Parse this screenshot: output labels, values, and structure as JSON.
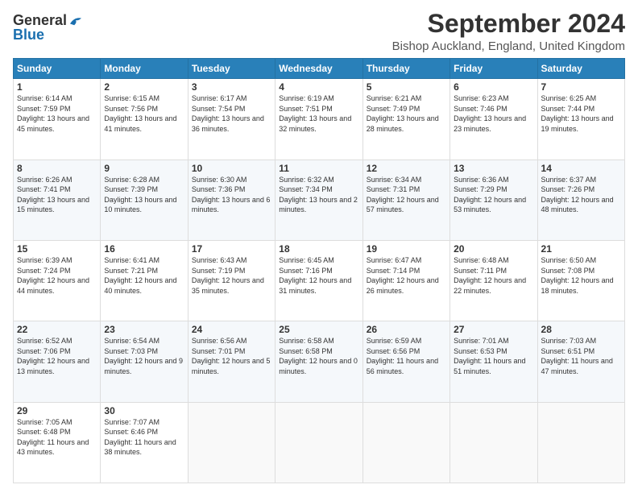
{
  "header": {
    "logo_general": "General",
    "logo_blue": "Blue",
    "month_title": "September 2024",
    "location": "Bishop Auckland, England, United Kingdom"
  },
  "days_of_week": [
    "Sunday",
    "Monday",
    "Tuesday",
    "Wednesday",
    "Thursday",
    "Friday",
    "Saturday"
  ],
  "weeks": [
    [
      {
        "day": "1",
        "sunrise": "6:14 AM",
        "sunset": "7:59 PM",
        "daylight": "13 hours and 45 minutes."
      },
      {
        "day": "2",
        "sunrise": "6:15 AM",
        "sunset": "7:56 PM",
        "daylight": "13 hours and 41 minutes."
      },
      {
        "day": "3",
        "sunrise": "6:17 AM",
        "sunset": "7:54 PM",
        "daylight": "13 hours and 36 minutes."
      },
      {
        "day": "4",
        "sunrise": "6:19 AM",
        "sunset": "7:51 PM",
        "daylight": "13 hours and 32 minutes."
      },
      {
        "day": "5",
        "sunrise": "6:21 AM",
        "sunset": "7:49 PM",
        "daylight": "13 hours and 28 minutes."
      },
      {
        "day": "6",
        "sunrise": "6:23 AM",
        "sunset": "7:46 PM",
        "daylight": "13 hours and 23 minutes."
      },
      {
        "day": "7",
        "sunrise": "6:25 AM",
        "sunset": "7:44 PM",
        "daylight": "13 hours and 19 minutes."
      }
    ],
    [
      {
        "day": "8",
        "sunrise": "6:26 AM",
        "sunset": "7:41 PM",
        "daylight": "13 hours and 15 minutes."
      },
      {
        "day": "9",
        "sunrise": "6:28 AM",
        "sunset": "7:39 PM",
        "daylight": "13 hours and 10 minutes."
      },
      {
        "day": "10",
        "sunrise": "6:30 AM",
        "sunset": "7:36 PM",
        "daylight": "13 hours and 6 minutes."
      },
      {
        "day": "11",
        "sunrise": "6:32 AM",
        "sunset": "7:34 PM",
        "daylight": "13 hours and 2 minutes."
      },
      {
        "day": "12",
        "sunrise": "6:34 AM",
        "sunset": "7:31 PM",
        "daylight": "12 hours and 57 minutes."
      },
      {
        "day": "13",
        "sunrise": "6:36 AM",
        "sunset": "7:29 PM",
        "daylight": "12 hours and 53 minutes."
      },
      {
        "day": "14",
        "sunrise": "6:37 AM",
        "sunset": "7:26 PM",
        "daylight": "12 hours and 48 minutes."
      }
    ],
    [
      {
        "day": "15",
        "sunrise": "6:39 AM",
        "sunset": "7:24 PM",
        "daylight": "12 hours and 44 minutes."
      },
      {
        "day": "16",
        "sunrise": "6:41 AM",
        "sunset": "7:21 PM",
        "daylight": "12 hours and 40 minutes."
      },
      {
        "day": "17",
        "sunrise": "6:43 AM",
        "sunset": "7:19 PM",
        "daylight": "12 hours and 35 minutes."
      },
      {
        "day": "18",
        "sunrise": "6:45 AM",
        "sunset": "7:16 PM",
        "daylight": "12 hours and 31 minutes."
      },
      {
        "day": "19",
        "sunrise": "6:47 AM",
        "sunset": "7:14 PM",
        "daylight": "12 hours and 26 minutes."
      },
      {
        "day": "20",
        "sunrise": "6:48 AM",
        "sunset": "7:11 PM",
        "daylight": "12 hours and 22 minutes."
      },
      {
        "day": "21",
        "sunrise": "6:50 AM",
        "sunset": "7:08 PM",
        "daylight": "12 hours and 18 minutes."
      }
    ],
    [
      {
        "day": "22",
        "sunrise": "6:52 AM",
        "sunset": "7:06 PM",
        "daylight": "12 hours and 13 minutes."
      },
      {
        "day": "23",
        "sunrise": "6:54 AM",
        "sunset": "7:03 PM",
        "daylight": "12 hours and 9 minutes."
      },
      {
        "day": "24",
        "sunrise": "6:56 AM",
        "sunset": "7:01 PM",
        "daylight": "12 hours and 5 minutes."
      },
      {
        "day": "25",
        "sunrise": "6:58 AM",
        "sunset": "6:58 PM",
        "daylight": "12 hours and 0 minutes."
      },
      {
        "day": "26",
        "sunrise": "6:59 AM",
        "sunset": "6:56 PM",
        "daylight": "11 hours and 56 minutes."
      },
      {
        "day": "27",
        "sunrise": "7:01 AM",
        "sunset": "6:53 PM",
        "daylight": "11 hours and 51 minutes."
      },
      {
        "day": "28",
        "sunrise": "7:03 AM",
        "sunset": "6:51 PM",
        "daylight": "11 hours and 47 minutes."
      }
    ],
    [
      {
        "day": "29",
        "sunrise": "7:05 AM",
        "sunset": "6:48 PM",
        "daylight": "11 hours and 43 minutes."
      },
      {
        "day": "30",
        "sunrise": "7:07 AM",
        "sunset": "6:46 PM",
        "daylight": "11 hours and 38 minutes."
      },
      null,
      null,
      null,
      null,
      null
    ]
  ]
}
